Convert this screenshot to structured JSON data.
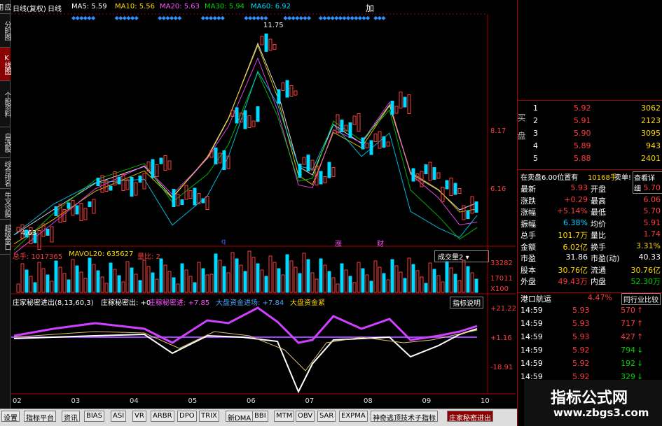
{
  "nav": [
    "应用",
    "分时图",
    "K线图",
    "个股资料",
    "自选股",
    "综合排名",
    "牛叉诊股",
    "超级盘口"
  ],
  "nav_active": 2,
  "header": {
    "period": "日线(复权)",
    "mode": "日线",
    "ma5": "MA5: 5.59",
    "ma10": "MA10: 5.56",
    "ma20": "MA20: 5.63",
    "ma30": "MA30: 5.94",
    "ma60": "MA60: 6.92",
    "add": "加"
  },
  "price_axis": {
    "high": "8.17",
    "low": "6.16"
  },
  "annotations": {
    "peak": "11.75",
    "low": "4.63",
    "q": "q",
    "zhang": "涨",
    "cai": "财"
  },
  "volume": {
    "total": "总手: 1017365",
    "mavol": "MAVOL20: 635627",
    "liangbi": "量比: 2",
    "selector": "成交量2",
    "axis_top": "33282",
    "axis_mid": "17011",
    "axis_unit": "X100"
  },
  "indicator": {
    "title": "庄家秘密进出(8,13,60,3)",
    "zhuang": "庄稼秘密出: +0",
    "zhuang_in": "庄稼秘密进: +7.85",
    "big_in": "大盘资金进场: +7.84",
    "big_money": "大盘资金紧",
    "btn": "指标说明",
    "axis_top": "+21.22",
    "axis_mid": "+1.16",
    "axis_bot": "-18.91"
  },
  "months": [
    "02",
    "03",
    "04",
    "05",
    "06",
    "07",
    "08",
    "09",
    "10"
  ],
  "tabs": [
    "设置",
    "指标平台",
    "资讯",
    "BIAS",
    "ASI",
    "VR",
    "ARBR",
    "DPO",
    "TRIX",
    "新DMA",
    "BBI",
    "MTM",
    "OBV",
    "SAR",
    "EXPMA",
    "神奇逃顶技术子指标",
    "庄家秘密进出"
  ],
  "orderbook": {
    "sell_label": "卖盘",
    "buy_label": "买盘",
    "rows": [
      {
        "n": "1",
        "p": "5.92",
        "v": "3062"
      },
      {
        "n": "2",
        "p": "5.91",
        "v": "2123"
      },
      {
        "n": "3",
        "p": "5.90",
        "v": "3095"
      },
      {
        "n": "4",
        "p": "5.89",
        "v": "943"
      },
      {
        "n": "5",
        "p": "5.88",
        "v": "2401"
      }
    ],
    "note": "在卖盘6.00位置有",
    "note_val": "10168手",
    "sell_tag": "卖单!",
    "detail": "查看详细"
  },
  "quote": [
    {
      "l": "最新",
      "v": "5.93",
      "l2": "开盘",
      "v2": "5.70"
    },
    {
      "l": "涨跌",
      "v": "+0.29",
      "l2": "最高",
      "v2": "6.06"
    },
    {
      "l": "涨幅",
      "v": "+5.14%",
      "l2": "最低",
      "v2": "5.70"
    },
    {
      "l": "振幅",
      "v": "6.38%",
      "l2": "均价",
      "v2": "5.91"
    },
    {
      "l": "总手",
      "v": "101.7万",
      "l2": "量比",
      "v2": "1.74"
    },
    {
      "l": "金额",
      "v": "6.02亿",
      "l2": "换手",
      "v2": "3.31%"
    },
    {
      "l": "市盈",
      "v": "31.86",
      "l2": "市盈(动)",
      "v2": "40.33"
    },
    {
      "l": "股本",
      "v": "30.76亿",
      "l2": "流通",
      "v2": "30.76亿"
    },
    {
      "l": "外盘",
      "v": "49.43万",
      "l2": "内盘",
      "v2": "52.30万"
    }
  ],
  "industry": {
    "name": "港口航运",
    "pct": "4.47%",
    "btn": "同行业比较"
  },
  "ticks": [
    {
      "t": "14:59",
      "p": "5.93",
      "v": "570",
      "dir": "up"
    },
    {
      "t": "14:59",
      "p": "5.93",
      "v": "717",
      "dir": "up"
    },
    {
      "t": "14:59",
      "p": "5.93",
      "v": "427",
      "dir": "up"
    },
    {
      "t": "14:59",
      "p": "5.92",
      "v": "794",
      "dir": "down"
    },
    {
      "t": "14:59",
      "p": "5.92",
      "v": "192",
      "dir": "down"
    },
    {
      "t": "14:59",
      "p": "5.92",
      "v": "329",
      "dir": "down"
    }
  ],
  "watermark": {
    "title": "指标公式网",
    "url": "www.zbgs3.com"
  }
}
